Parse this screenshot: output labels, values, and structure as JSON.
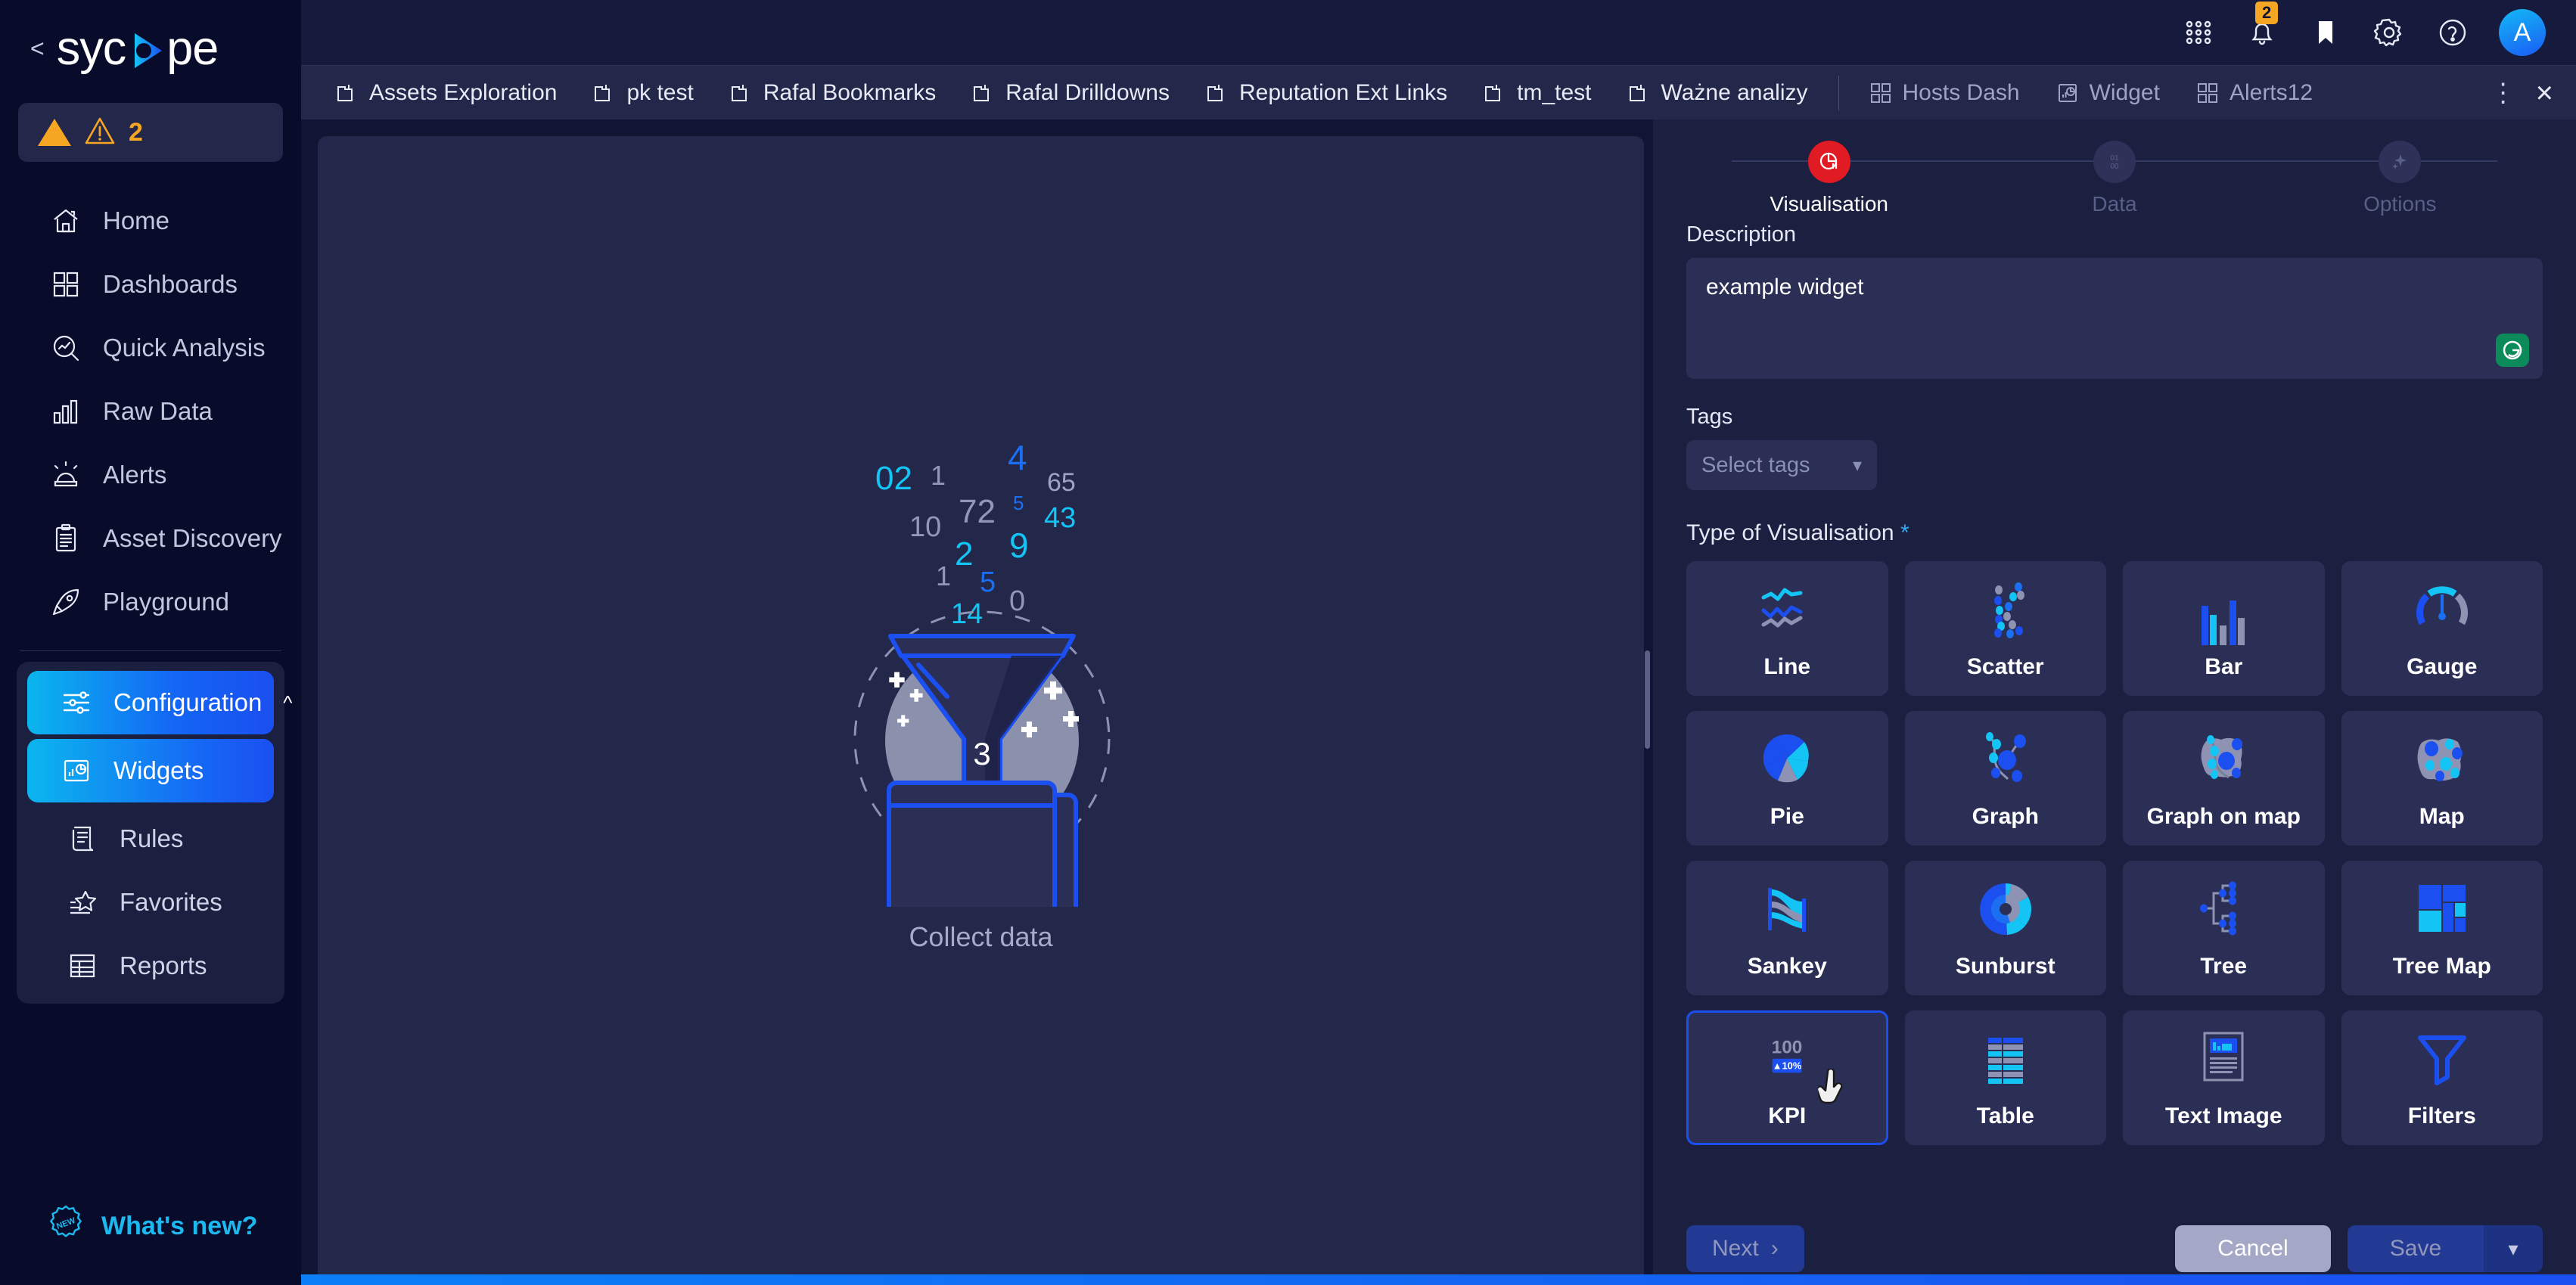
{
  "brand": {
    "name": "sycope",
    "back_label": "<"
  },
  "sidebar": {
    "alert_count": "2",
    "items": [
      {
        "label": "Home",
        "icon": "home-icon"
      },
      {
        "label": "Dashboards",
        "icon": "dashboards-icon"
      },
      {
        "label": "Quick Analysis",
        "icon": "quick-analysis-icon"
      },
      {
        "label": "Raw Data",
        "icon": "raw-data-icon"
      },
      {
        "label": "Alerts",
        "icon": "alerts-icon"
      },
      {
        "label": "Asset Discovery",
        "icon": "asset-discovery-icon"
      },
      {
        "label": "Playground",
        "icon": "playground-icon"
      }
    ],
    "config": {
      "label": "Configuration",
      "expanded": true,
      "children": [
        {
          "label": "Widgets",
          "icon": "widgets-icon",
          "selected": true
        },
        {
          "label": "Rules",
          "icon": "rules-icon",
          "selected": false
        },
        {
          "label": "Favorites",
          "icon": "favorites-icon",
          "selected": false
        },
        {
          "label": "Reports",
          "icon": "reports-icon",
          "selected": false
        }
      ]
    },
    "whats_new": "What's new?"
  },
  "topbar": {
    "icons": [
      "apps-grid-icon",
      "bell-icon",
      "bookmark-icon",
      "gear-icon",
      "help-icon"
    ],
    "notification_count": "2",
    "avatar_initial": "A"
  },
  "tabs": [
    {
      "label": "Assets Exploration",
      "icon": "folder-icon",
      "type": "folder"
    },
    {
      "label": "pk test",
      "icon": "folder-icon",
      "type": "folder"
    },
    {
      "label": "Rafal Bookmarks",
      "icon": "folder-icon",
      "type": "folder"
    },
    {
      "label": "Rafal Drilldowns",
      "icon": "folder-icon",
      "type": "folder"
    },
    {
      "label": "Reputation Ext Links",
      "icon": "folder-icon",
      "type": "folder"
    },
    {
      "label": "tm_test",
      "icon": "folder-icon",
      "type": "folder"
    },
    {
      "label": "Ważne analizy",
      "icon": "folder-icon",
      "type": "folder"
    },
    {
      "label": "Hosts Dash",
      "icon": "dashboard-icon",
      "type": "dash"
    },
    {
      "label": "Widget",
      "icon": "widget-icon",
      "type": "dash"
    },
    {
      "label": "Alerts12",
      "icon": "dashboard-icon",
      "type": "dash"
    }
  ],
  "preview": {
    "caption": "Collect data",
    "falling_numbers": [
      "02",
      "1",
      "4",
      "65",
      "72",
      "5",
      "43",
      "10",
      "2",
      "9",
      "1",
      "5",
      "0",
      "14"
    ],
    "funnel_number": "3"
  },
  "wizard": {
    "steps": [
      {
        "label": "Visualisation",
        "state": "error",
        "icon": "chart-icon"
      },
      {
        "label": "Data",
        "state": "inactive",
        "icon": "binary-icon"
      },
      {
        "label": "Options",
        "state": "inactive",
        "icon": "sparkle-icon"
      }
    ],
    "description_label": "Description",
    "description_value": "example widget",
    "grammarly_icon": "grammarly-icon",
    "tags_label": "Tags",
    "tags_placeholder": "Select tags",
    "viz_title": "Type of Visualisation",
    "viz_required_mark": "*",
    "viz_types": [
      {
        "label": "Line",
        "icon": "line-chart-icon",
        "selected": false
      },
      {
        "label": "Scatter",
        "icon": "scatter-chart-icon",
        "selected": false
      },
      {
        "label": "Bar",
        "icon": "bar-chart-icon",
        "selected": false
      },
      {
        "label": "Gauge",
        "icon": "gauge-icon",
        "selected": false
      },
      {
        "label": "Pie",
        "icon": "pie-chart-icon",
        "selected": false
      },
      {
        "label": "Graph",
        "icon": "graph-icon",
        "selected": false
      },
      {
        "label": "Graph on map",
        "icon": "graph-on-map-icon",
        "selected": false
      },
      {
        "label": "Map",
        "icon": "map-icon",
        "selected": false
      },
      {
        "label": "Sankey",
        "icon": "sankey-icon",
        "selected": false
      },
      {
        "label": "Sunburst",
        "icon": "sunburst-icon",
        "selected": false
      },
      {
        "label": "Tree",
        "icon": "tree-icon",
        "selected": false
      },
      {
        "label": "Tree Map",
        "icon": "tree-map-icon",
        "selected": false
      },
      {
        "label": "KPI",
        "icon": "kpi-icon",
        "selected": true
      },
      {
        "label": "Table",
        "icon": "table-icon",
        "selected": false
      },
      {
        "label": "Text Image",
        "icon": "text-image-icon",
        "selected": false
      },
      {
        "label": "Filters",
        "icon": "filters-icon",
        "selected": false
      }
    ],
    "kpi_tile": {
      "value": "100",
      "delta": "▲10%"
    },
    "buttons": {
      "next": "Next",
      "cancel": "Cancel",
      "save": "Save"
    }
  },
  "colors": {
    "accent_blue": "#1b4ff0",
    "accent_cyan": "#0bb6ee",
    "error_red": "#e01b24",
    "warn_orange": "#f5a623",
    "panel_bg": "#1b1f40",
    "tile_bg": "#2b2f55"
  }
}
